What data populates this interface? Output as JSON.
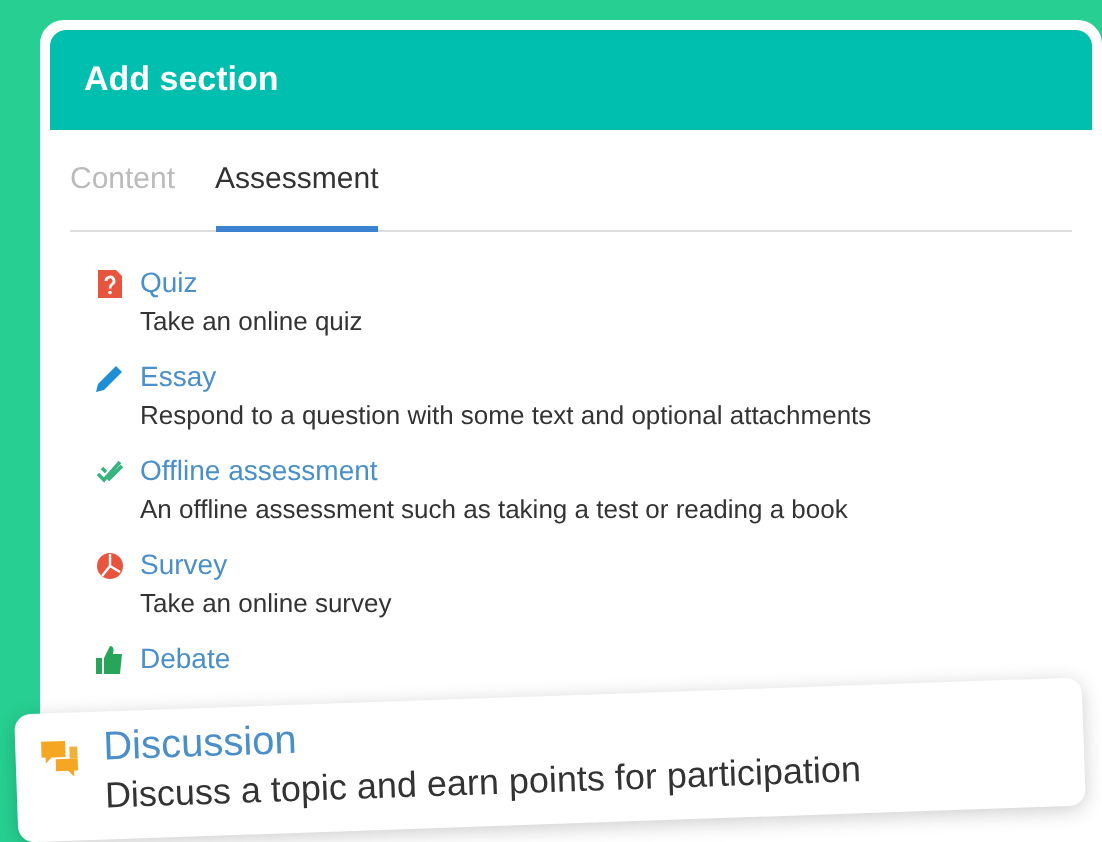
{
  "dialog": {
    "title": "Add section"
  },
  "tabs": [
    {
      "label": "Content",
      "selected": false
    },
    {
      "label": "Assessment",
      "selected": true
    }
  ],
  "items": [
    {
      "kind": "quiz",
      "title": "Quiz",
      "description": "Take an online quiz"
    },
    {
      "kind": "essay",
      "title": "Essay",
      "description": "Respond to a question with some text and optional attachments"
    },
    {
      "kind": "offline",
      "title": "Offline assessment",
      "description": "An offline assessment such as taking a test or reading a book"
    },
    {
      "kind": "survey",
      "title": "Survey",
      "description": "Take an online survey"
    },
    {
      "kind": "debate",
      "title": "Debate"
    }
  ],
  "callout": {
    "kind": "discussion",
    "title": "Discussion",
    "description": "Discuss a topic and earn points for participation"
  }
}
